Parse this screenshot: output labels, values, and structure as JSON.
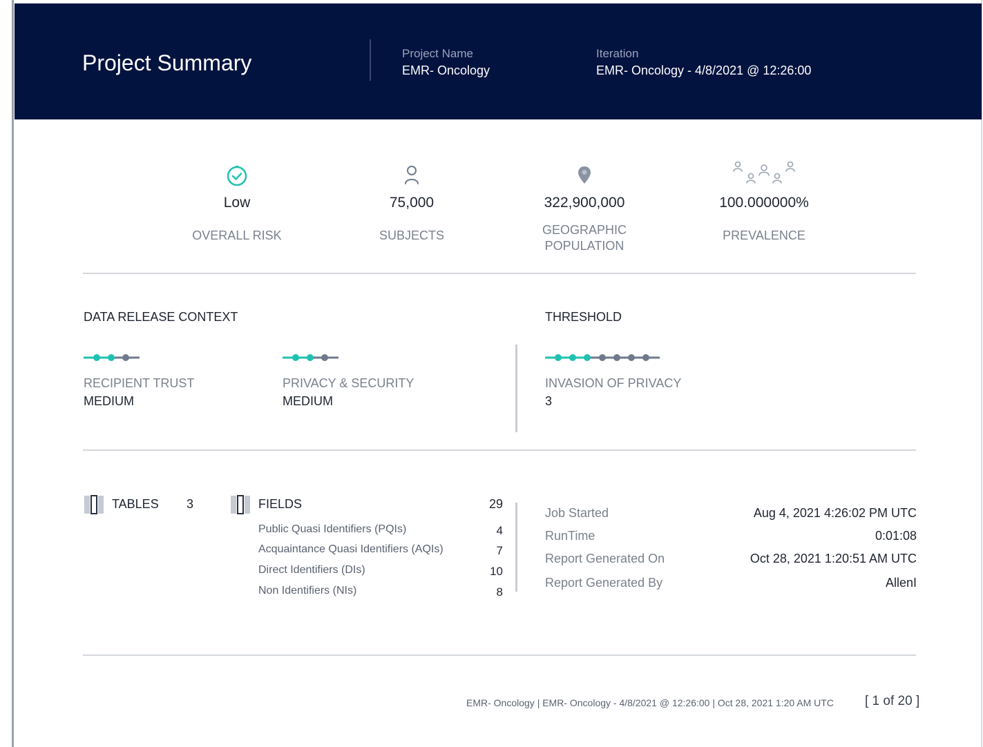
{
  "header": {
    "title": "Project Summary",
    "project_name_label": "Project Name",
    "project_name": "EMR- Oncology",
    "iteration_label": "Iteration",
    "iteration": "EMR- Oncology - 4/8/2021 @ 12:26:00"
  },
  "metrics": {
    "overall_risk": {
      "value": "Low",
      "label": "OVERALL RISK"
    },
    "subjects": {
      "value": "75,000",
      "label": "SUBJECTS"
    },
    "geographic_population": {
      "value": "322,900,000",
      "label_line1": "GEOGRAPHIC",
      "label_line2": "POPULATION"
    },
    "prevalence": {
      "value": "100.000000%",
      "label": "PREVALENCE"
    }
  },
  "data_release_context": {
    "title": "DATA RELEASE CONTEXT",
    "recipient_trust": {
      "label": "RECIPIENT TRUST",
      "value": "MEDIUM",
      "level": 2,
      "max": 3
    },
    "privacy_security": {
      "label": "PRIVACY & SECURITY",
      "value": "MEDIUM",
      "level": 2,
      "max": 3
    }
  },
  "threshold": {
    "title": "THRESHOLD",
    "invasion_of_privacy": {
      "label": "INVASION OF PRIVACY",
      "value": "3",
      "level": 3,
      "max": 7
    }
  },
  "tables": {
    "label": "TABLES",
    "count": "3"
  },
  "fields": {
    "label": "FIELDS",
    "count": "29",
    "rows": [
      {
        "label": "Public Quasi Identifiers (PQIs)",
        "count": "4"
      },
      {
        "label": "Acquaintance Quasi Identifiers (AQIs)",
        "count": "7"
      },
      {
        "label": "Direct Identifiers (DIs)",
        "count": "10"
      },
      {
        "label": "Non Identifiers (NIs)",
        "count": "8"
      }
    ]
  },
  "job": [
    {
      "label": "Job Started",
      "value": "Aug 4, 2021 4:26:02 PM UTC"
    },
    {
      "label": "RunTime",
      "value": "0:01:08"
    },
    {
      "label": "Report Generated On",
      "value": "Oct 28, 2021 1:20:51 AM UTC"
    },
    {
      "label": "Report Generated By",
      "value": "AllenI"
    }
  ],
  "footer": {
    "text": "EMR- Oncology | EMR- Oncology - 4/8/2021 @ 12:26:00 | Oct 28, 2021 1:20 AM UTC",
    "page": "[ 1 of 20 ]"
  },
  "colors": {
    "header_bg": "#03133f",
    "accent_teal": "#1fc2b1",
    "dot_inactive": "#6f7a8c"
  }
}
